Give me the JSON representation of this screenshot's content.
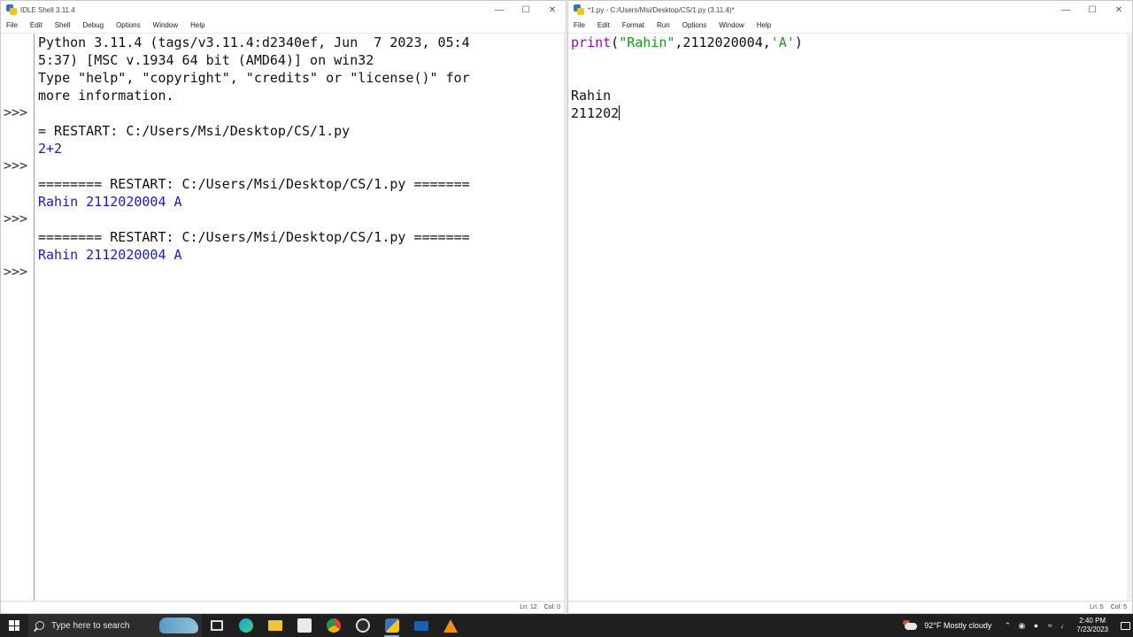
{
  "shell": {
    "title": "IDLE Shell 3.11.4",
    "menu": [
      "File",
      "Edit",
      "Shell",
      "Debug",
      "Options",
      "Window",
      "Help"
    ],
    "prompts": [
      ">>>",
      ">>>",
      ">>>",
      ">>>"
    ],
    "lines": [
      {
        "text": "Python 3.11.4 (tags/v3.11.4:d2340ef, Jun  7 2023, 05:4",
        "kind": "plain"
      },
      {
        "text": "5:37) [MSC v.1934 64 bit (AMD64)] on win32",
        "kind": "plain"
      },
      {
        "text": "Type \"help\", \"copyright\", \"credits\" or \"license()\" for",
        "kind": "plain"
      },
      {
        "text": "more information.",
        "kind": "plain"
      },
      {
        "text": "",
        "kind": "plain"
      },
      {
        "text": "= RESTART: C:/Users/Msi/Desktop/CS/1.py",
        "kind": "plain"
      },
      {
        "text": "2+2",
        "kind": "out"
      },
      {
        "text": "",
        "kind": "plain"
      },
      {
        "text": "======== RESTART: C:/Users/Msi/Desktop/CS/1.py =======",
        "kind": "plain"
      },
      {
        "text": "Rahin 2112020004 A",
        "kind": "out"
      },
      {
        "text": "",
        "kind": "plain"
      },
      {
        "text": "======== RESTART: C:/Users/Msi/Desktop/CS/1.py =======",
        "kind": "plain"
      },
      {
        "text": "Rahin 2112020004 A",
        "kind": "out"
      }
    ],
    "status_ln": "Ln: 12",
    "status_col": "Col: 0"
  },
  "editor": {
    "title": "*1.py - C:/Users/Msi/Desktop/CS/1.py (3.11.4)*",
    "menu": [
      "File",
      "Edit",
      "Format",
      "Run",
      "Options",
      "Window",
      "Help"
    ],
    "code_kw": "print",
    "code_paren_open": "(",
    "code_str1": "\"Rahin\"",
    "code_mid": ",2112020004,",
    "code_str2": "'A'",
    "code_paren_close": ")",
    "line3": "Rahin",
    "line4": "211202",
    "status_ln": "Ln: 5",
    "status_col": "Col: 5"
  },
  "taskbar": {
    "search_placeholder": "Type here to search",
    "weather_temp": "92°F",
    "weather_text": "Mostly cloudy",
    "time": "2:40 PM",
    "date": "7/23/2023"
  }
}
